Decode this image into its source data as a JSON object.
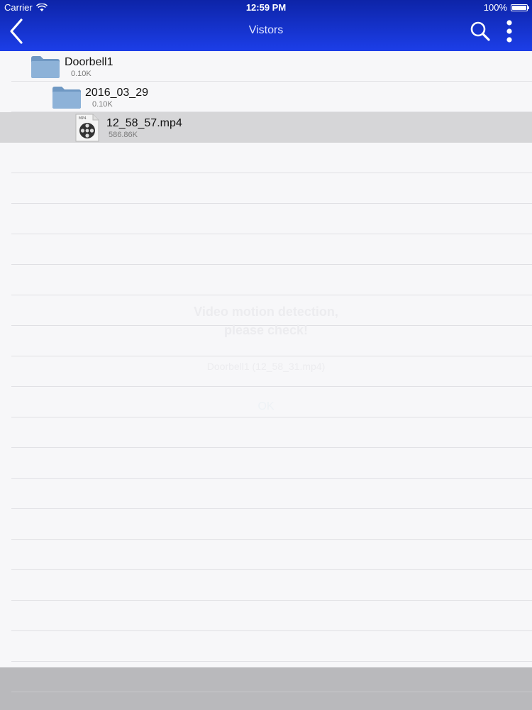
{
  "status_bar": {
    "carrier": "Carrier",
    "time": "12:59 PM",
    "battery": "100%"
  },
  "navbar": {
    "title": "Vistors",
    "back_icon": "chevron-left-icon",
    "search_icon": "search-icon",
    "more_icon": "more-vertical-icon"
  },
  "files": [
    {
      "name": "Doorbell1",
      "size": "0.10K",
      "type": "folder"
    },
    {
      "name": "2016_03_29",
      "size": "0.10K",
      "type": "folder"
    },
    {
      "name": "12_58_57.mp4",
      "size": "586.86K",
      "type": "mp4",
      "badge": "MP4"
    }
  ],
  "alert": {
    "title_line1": "Video motion detection,",
    "title_line2": "please check!",
    "message": "Doorbell1 (12_58_31.mp4)",
    "ok_label": "OK"
  },
  "colors": {
    "navbar_top": "#0d24a8",
    "navbar_bottom": "#1c3ee8",
    "selected_row": "#d6d6d8",
    "folder_blue": "#7fa6cf"
  }
}
